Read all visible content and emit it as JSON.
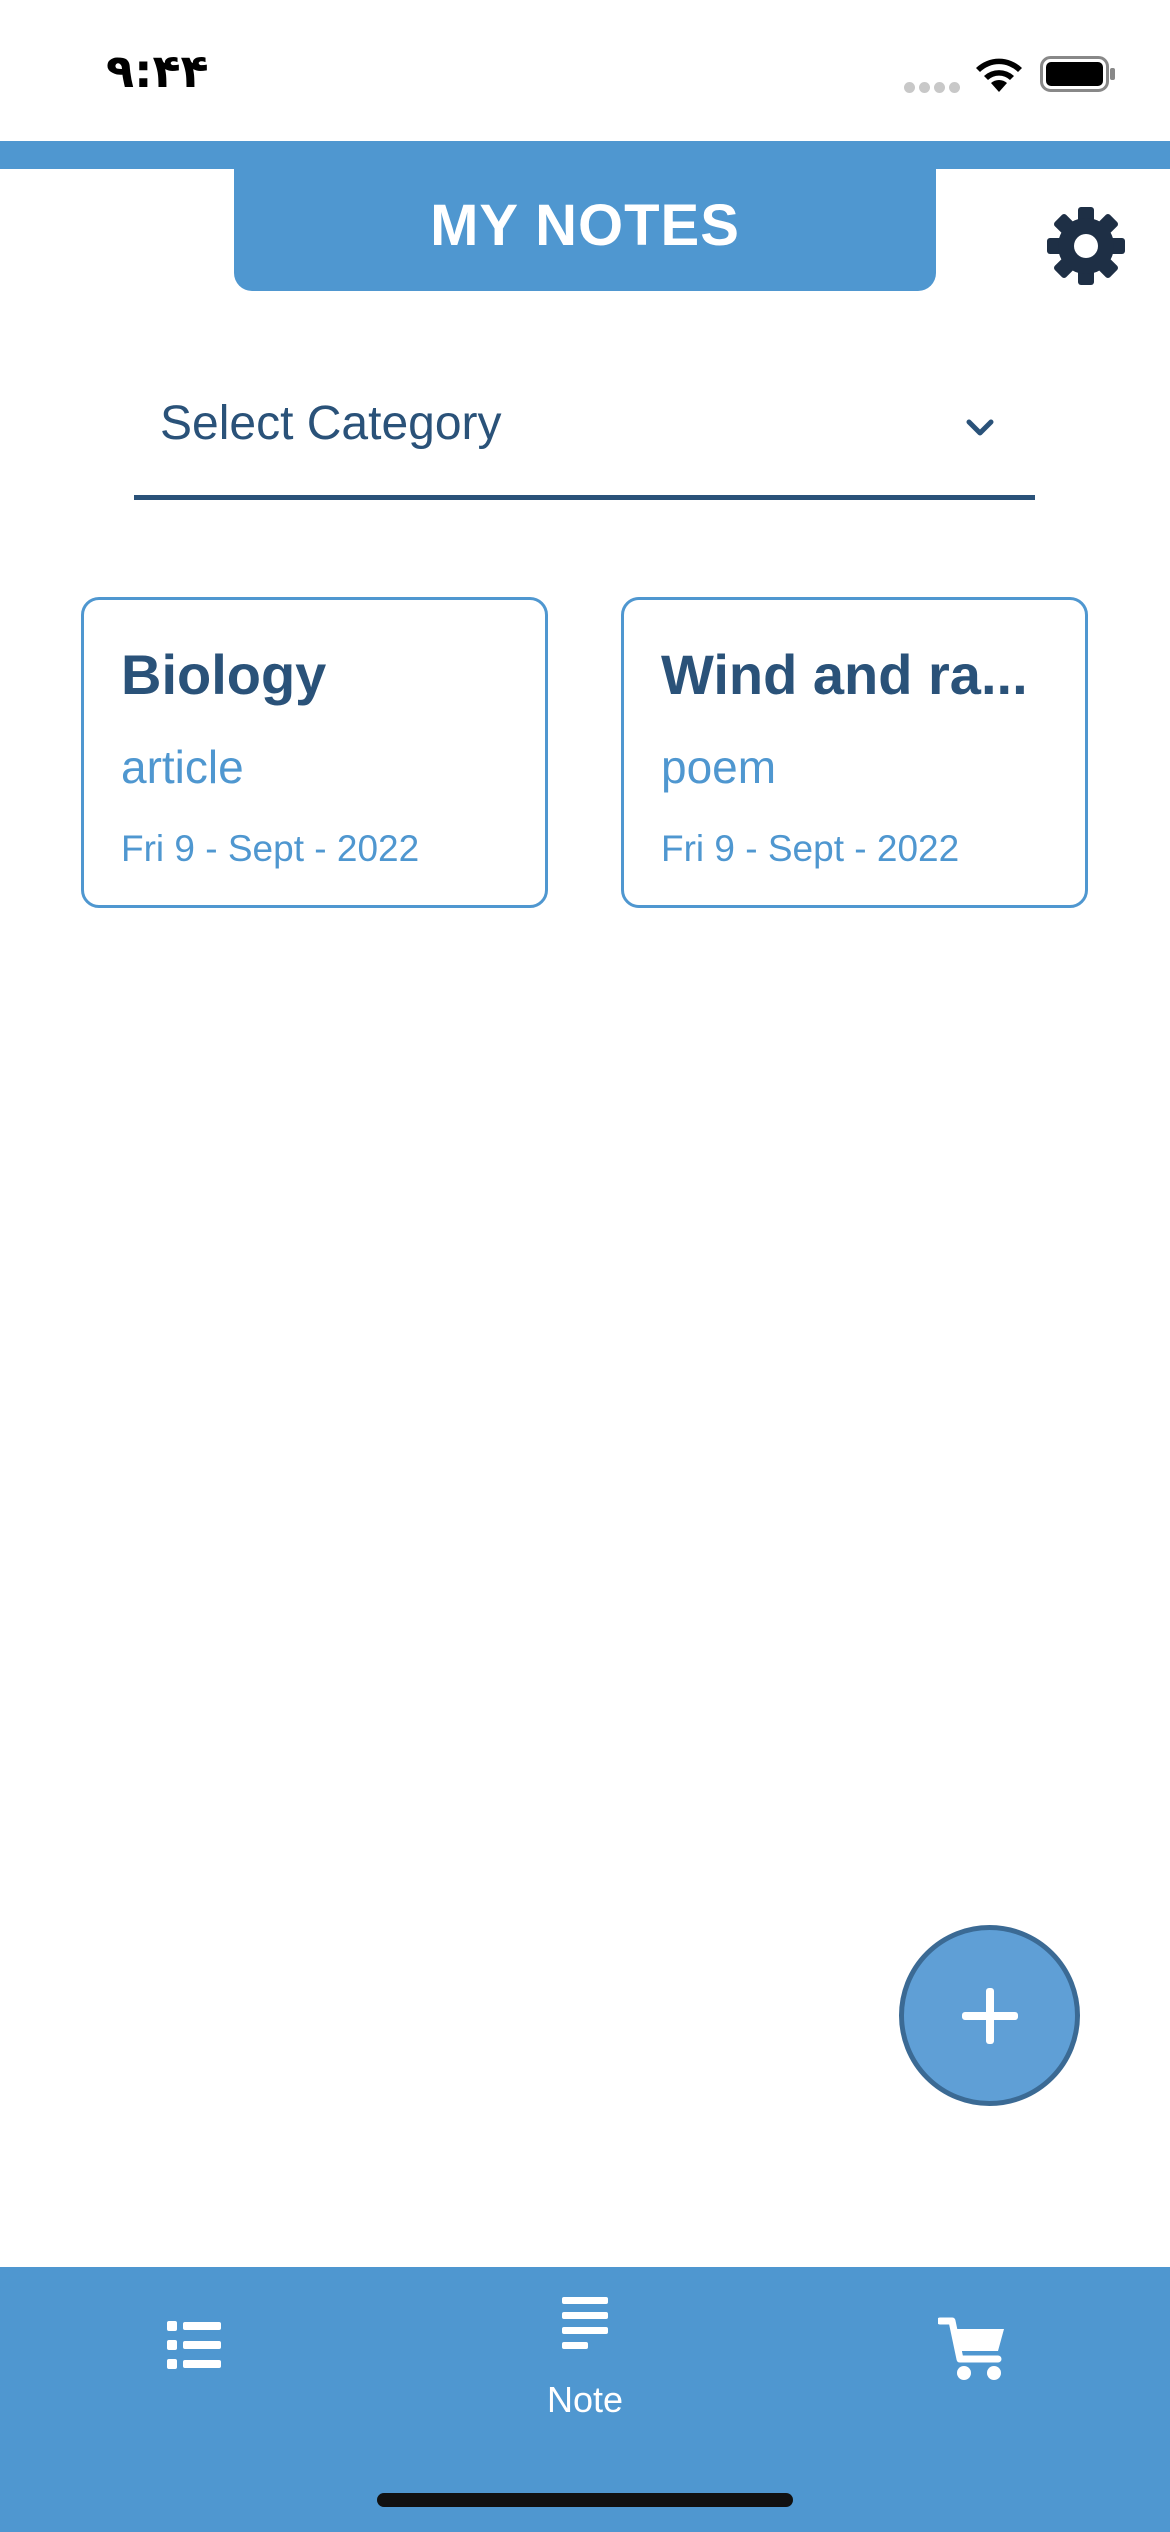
{
  "status_bar": {
    "time": "۹:۴۴",
    "icons": [
      "cellular-signal-icon",
      "wifi-icon",
      "battery-icon"
    ]
  },
  "header": {
    "title": "MY NOTES",
    "settings_icon": "gear-icon"
  },
  "category_select": {
    "label": "Select Category",
    "icon": "chevron-down-icon"
  },
  "notes": [
    {
      "title": "Biology",
      "category": "article",
      "date": "Fri 9 - Sept - 2022"
    },
    {
      "title": "Wind and ra...",
      "category": "poem",
      "date": "Fri 9 - Sept - 2022"
    }
  ],
  "fab": {
    "icon": "plus-icon"
  },
  "bottom_nav": {
    "items": [
      {
        "icon": "list-icon",
        "label": ""
      },
      {
        "icon": "note-lines-icon",
        "label": "Note"
      },
      {
        "icon": "cart-icon",
        "label": ""
      }
    ]
  },
  "colors": {
    "primary": "#4f97d0",
    "dark_text": "#2a5279",
    "fab": "#5f9fd6",
    "fab_border": "#3b6a94",
    "white": "#ffffff"
  }
}
